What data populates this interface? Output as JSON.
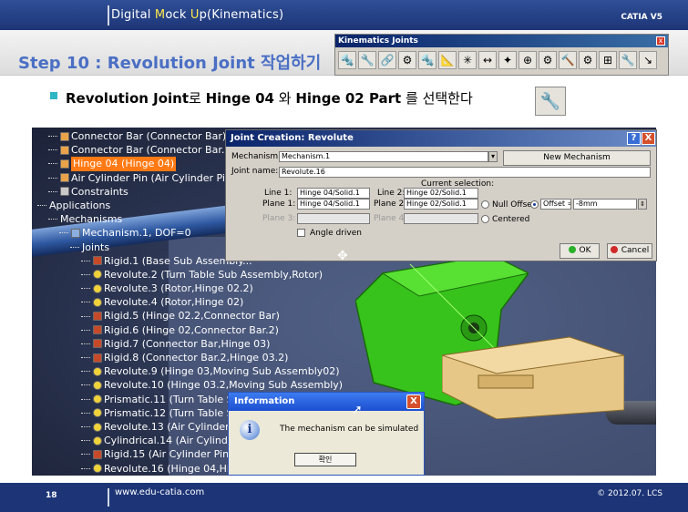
{
  "header": {
    "deck_title_1": "Digital ",
    "deck_title_m": "M",
    "deck_title_2": "ock ",
    "deck_title_u": "U",
    "deck_title_3": "p(Kinematics)",
    "product": "CATIA V5",
    "step_title": "Step 10 : Revolution Joint 작업하기"
  },
  "kinematics_toolbar": {
    "title": "Kinematics Joints",
    "close": "x",
    "icons": [
      "🔩",
      "🔧",
      "🔗",
      "⚙",
      "🔩",
      "📐",
      "✳",
      "↔",
      "✦",
      "⊕",
      "⚙",
      "🔨",
      "⚙",
      "⊞",
      "🔧",
      "↘"
    ]
  },
  "bullet": {
    "part1": "Revolution Joint",
    "part2": "로 ",
    "part3": "Hinge 04",
    "part4": " 와 ",
    "part5": "Hinge 02 Part",
    "part6": " 를 선택한다",
    "icon": "🔧"
  },
  "tree": {
    "items": [
      {
        "label": "Connector Bar (Connector Bar)",
        "indent": 1,
        "icon": "part"
      },
      {
        "label": "Connector Bar (Connector Bar.2)",
        "indent": 1,
        "icon": "part"
      },
      {
        "label": "Hinge 04 (Hinge 04)",
        "indent": 1,
        "icon": "part",
        "highlight": true
      },
      {
        "label": "Air Cylinder Pin (Air Cylinder Pin)",
        "indent": 1,
        "icon": "part"
      },
      {
        "label": "Constraints",
        "indent": 1,
        "icon": "gen"
      },
      {
        "label": "Applications",
        "indent": 0,
        "icon": "none"
      },
      {
        "label": "Mechanisms",
        "indent": 1,
        "icon": "none"
      },
      {
        "label": "Mechanism.1, DOF=0",
        "indent": 2,
        "icon": "mech"
      },
      {
        "label": "Joints",
        "indent": 3,
        "icon": "none"
      },
      {
        "label": "Rigid.1 (Base Sub Assembly...",
        "indent": 4,
        "icon": "rigid"
      },
      {
        "label": "Revolute.2 (Turn Table Sub Assembly,Rotor)",
        "indent": 4,
        "icon": "rev"
      },
      {
        "label": "Revolute.3 (Rotor,Hinge 02.2)",
        "indent": 4,
        "icon": "rev"
      },
      {
        "label": "Revolute.4 (Rotor,Hinge 02)",
        "indent": 4,
        "icon": "rev"
      },
      {
        "label": "Rigid.5 (Hinge 02.2,Connector Bar)",
        "indent": 4,
        "icon": "rigid"
      },
      {
        "label": "Rigid.6 (Hinge 02,Connector Bar.2)",
        "indent": 4,
        "icon": "rigid"
      },
      {
        "label": "Rigid.7 (Connector Bar,Hinge 03)",
        "indent": 4,
        "icon": "rigid"
      },
      {
        "label": "Rigid.8 (Connector Bar.2,Hinge 03.2)",
        "indent": 4,
        "icon": "rigid"
      },
      {
        "label": "Revolute.9 (Hinge 03,Moving Sub Assembly02)",
        "indent": 4,
        "icon": "rev"
      },
      {
        "label": "Revolute.10 (Hinge 03.2,Moving Sub Assembly)",
        "indent": 4,
        "icon": "rev"
      },
      {
        "label": "Prismatic.11 (Turn Table Sub...",
        "indent": 4,
        "icon": "rev"
      },
      {
        "label": "Prismatic.12 (Turn Table Sub...",
        "indent": 4,
        "icon": "rev"
      },
      {
        "label": "Revolute.13 (Air Cylinder Sub...",
        "indent": 4,
        "icon": "rev"
      },
      {
        "label": "Cylindrical.14 (Air Cylinder Su...",
        "indent": 4,
        "icon": "rev"
      },
      {
        "label": "Rigid.15 (Air Cylinder Pin,Hing...",
        "indent": 4,
        "icon": "rigid"
      },
      {
        "label": "Revolute.16 (Hinge 04,Hinge...",
        "indent": 4,
        "icon": "rev"
      }
    ]
  },
  "joint_dialog": {
    "title": "Joint Creation: Revolute",
    "help": "?",
    "close": "X",
    "mechanism_label": "Mechanism:",
    "mechanism_value": "Mechanism.1",
    "new_mechanism": "New Mechanism",
    "joint_name_label": "Joint name:",
    "joint_name_value": "Revolute.16",
    "current_selection": "Current selection:",
    "line1_label": "Line 1:",
    "line1_value": "Hinge 04/Solid.1",
    "line2_label": "Line 2:",
    "line2_value": "Hinge 02/Solid.1",
    "plane1_label": "Plane 1:",
    "plane1_value": "Hinge 04/Solid.1",
    "plane2_label": "Plane 2:",
    "plane2_value": "Hinge 02/Solid.1",
    "plane3_label": "Plane 3:",
    "plane4_label": "Plane 4:",
    "null_offset": "Null Offset",
    "offset_label": "Offset =",
    "offset_value": "-8mm",
    "centered": "Centered",
    "angle_driven": "Angle driven",
    "ok": "OK",
    "cancel": "Cancel"
  },
  "info_dialog": {
    "title": "Information",
    "close": "X",
    "icon": "i",
    "message": "The mechanism can be simulated",
    "ok": "확인"
  },
  "footer": {
    "page": "18",
    "site": "www.edu-catia.com",
    "copyright": "© 2012.07. LCS"
  }
}
